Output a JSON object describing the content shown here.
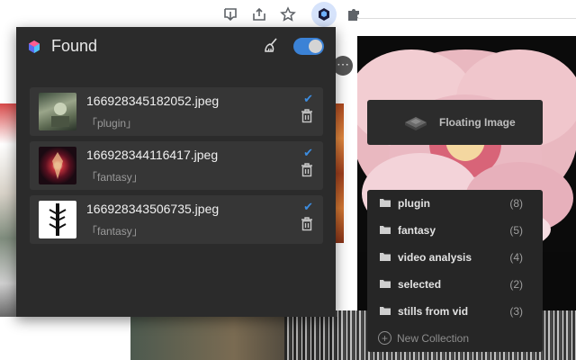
{
  "popup": {
    "title": "Found",
    "toggle_on": true,
    "items": [
      {
        "filename": "166928345182052.jpeg",
        "tag": "「plugin」"
      },
      {
        "filename": "166928344116417.jpeg",
        "tag": "「fantasy」"
      },
      {
        "filename": "166928343506735.jpeg",
        "tag": "「fantasy」"
      }
    ]
  },
  "floating": {
    "label": "Floating Image"
  },
  "collections": {
    "items": [
      {
        "name": "plugin",
        "count": "(8)"
      },
      {
        "name": "fantasy",
        "count": "(5)"
      },
      {
        "name": "video analysis",
        "count": "(4)"
      },
      {
        "name": "selected",
        "count": "(2)"
      },
      {
        "name": "stills from vid",
        "count": "(3)"
      }
    ],
    "new_label": "New Collection"
  },
  "colors": {
    "accent": "#3b82d6",
    "panel": "#2b2b2b",
    "item": "#363636"
  },
  "icons": [
    "download-icon",
    "share-icon",
    "star-icon",
    "extension-icon",
    "puzzle-icon",
    "broom-icon",
    "trash-icon",
    "check-icon",
    "folder-icon",
    "plus-icon"
  ]
}
